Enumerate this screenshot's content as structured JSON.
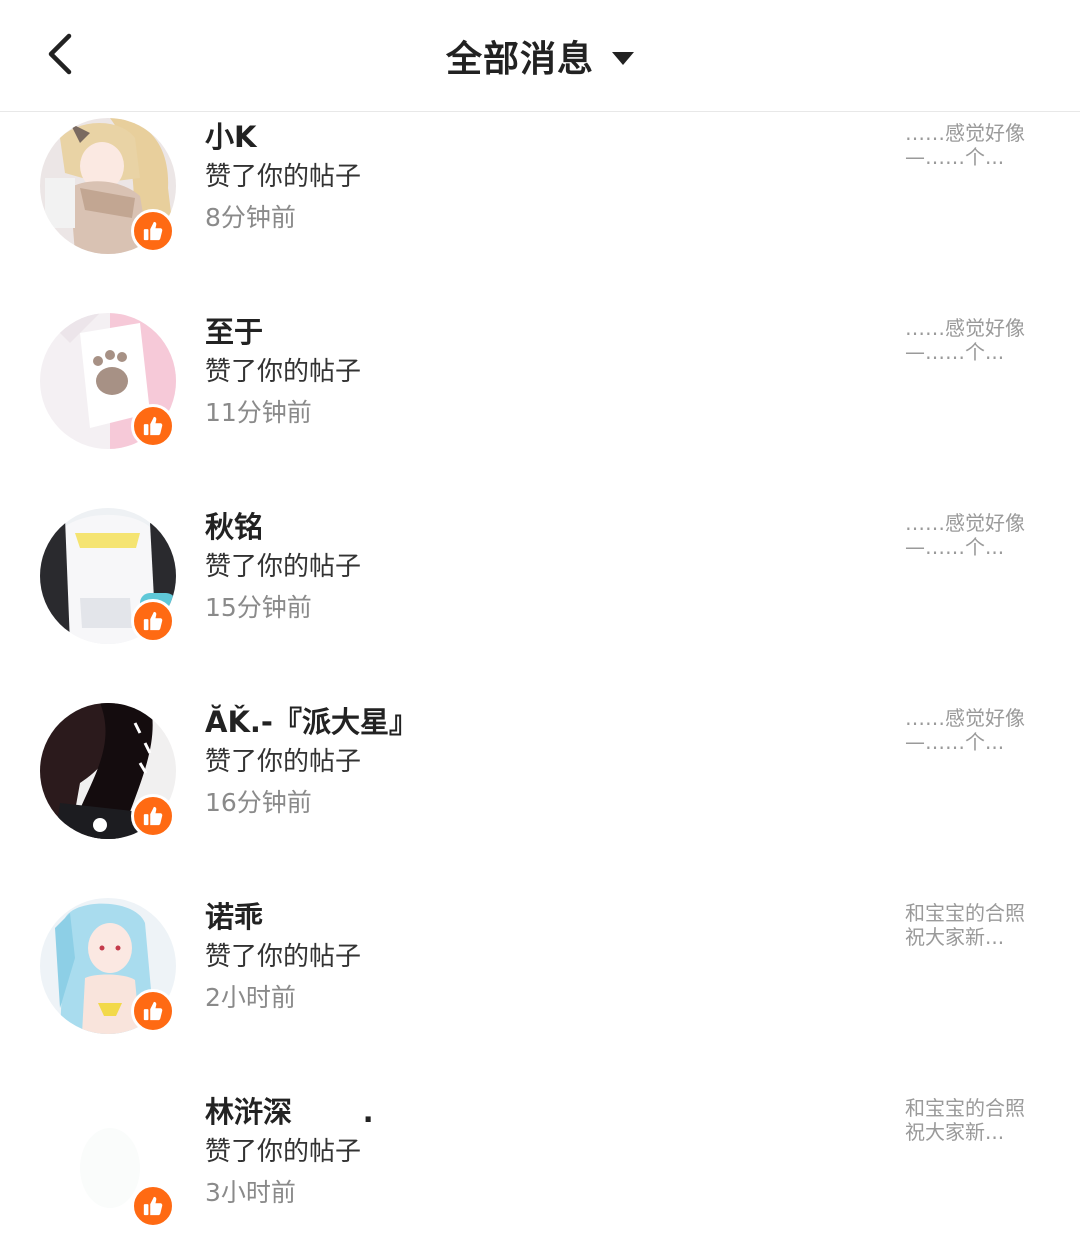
{
  "header": {
    "title": "全部消息"
  },
  "messages": [
    {
      "name": "小K",
      "action": "赞了你的帖子",
      "time": "8分钟前",
      "preview_line1": "……感觉好像",
      "preview_line2": "—……个..."
    },
    {
      "name": "至于",
      "action": "赞了你的帖子",
      "time": "11分钟前",
      "preview_line1": "……感觉好像",
      "preview_line2": "—……个..."
    },
    {
      "name": "秋铭",
      "action": "赞了你的帖子",
      "time": "15分钟前",
      "preview_line1": "……感觉好像",
      "preview_line2": "—……个..."
    },
    {
      "name": "ĂǨ.-『派大星』",
      "action": "赞了你的帖子",
      "time": "16分钟前",
      "preview_line1": "……感觉好像",
      "preview_line2": "—……个..."
    },
    {
      "name": "诺乖",
      "action": "赞了你的帖子",
      "time": "2小时前",
      "preview_line1": "和宝宝的合照",
      "preview_line2": "祝大家新..."
    },
    {
      "name": "林浒深       .",
      "action": "赞了你的帖子",
      "time": "3小时前",
      "preview_line1": "和宝宝的合照",
      "preview_line2": "祝大家新..."
    }
  ],
  "colors": {
    "accent": "#ff6a13",
    "title": "#222222",
    "secondary_text": "#8a8a8a",
    "preview_text": "#9a9a9a"
  },
  "icons": {
    "back": "chevron-left-icon",
    "dropdown": "caret-down-icon",
    "like": "thumbs-up-icon"
  }
}
